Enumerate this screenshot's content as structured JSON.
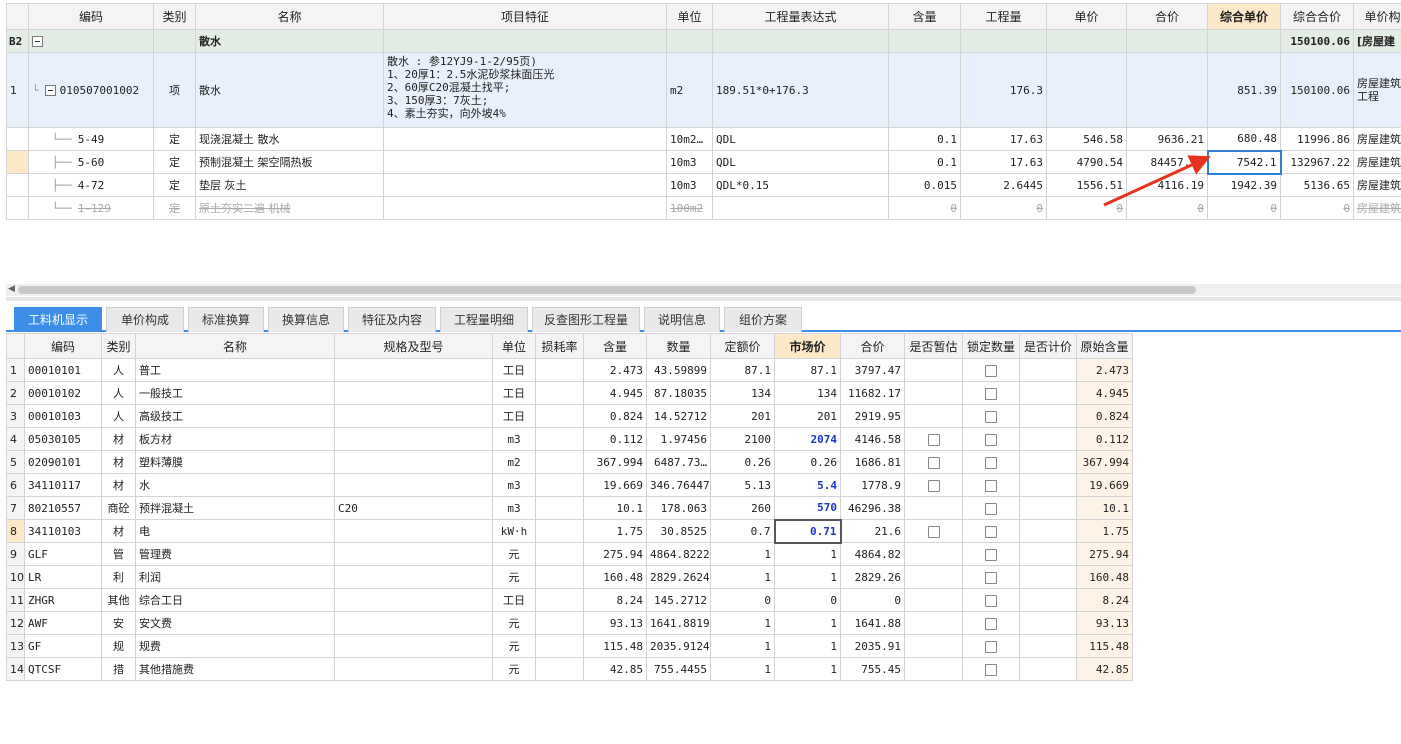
{
  "top": {
    "headers": [
      "编码",
      "类别",
      "名称",
      "项目特征",
      "单位",
      "工程量表达式",
      "含量",
      "工程量",
      "单价",
      "合价",
      "综合单价",
      "综合合价",
      "单价构"
    ],
    "group": {
      "idx": "B2",
      "name": "散水",
      "total": "150100.06",
      "spec": "[房屋建"
    },
    "item": {
      "idx": "1",
      "code": "010507001002",
      "type": "项",
      "name": "散水",
      "features": [
        "散水 : 参12YJ9-1-2/95页)",
        "1、20厚1：2.5水泥砂浆抹面压光",
        "2、60厚C20混凝土找平;",
        "3、150厚3：7灰土;",
        "4、素土夯实，向外坡4%"
      ],
      "unit": "m2",
      "expr": "189.51*0+176.3",
      "qty": "176.3",
      "comp_price": "851.39",
      "comp_total": "150100.06",
      "spec": "房屋建筑",
      "spec2": "工程"
    },
    "subitems": [
      {
        "code": "5-49",
        "type": "定",
        "name": "现浇混凝土 散水",
        "unit": "10m2…",
        "expr": "QDL",
        "content": "0.1",
        "qty": "17.63",
        "price": "546.58",
        "total": "9636.21",
        "comp_price": "680.48",
        "comp_total": "11996.86",
        "spec": "房屋建筑"
      },
      {
        "code": "5-60",
        "type": "定",
        "name": "预制混凝土 架空隔热板",
        "unit": "10m3",
        "expr": "QDL",
        "content": "0.1",
        "qty": "17.63",
        "price": "4790.54",
        "total": "84457.20",
        "comp_price": "7542.1",
        "comp_total": "132967.22",
        "spec": "房屋建筑"
      },
      {
        "code": "4-72",
        "type": "定",
        "name": "垫层 灰土",
        "unit": "10m3",
        "expr": "QDL*0.15",
        "content": "0.015",
        "qty": "2.6445",
        "price": "1556.51",
        "total": "4116.19",
        "comp_price": "1942.39",
        "comp_total": "5136.65",
        "spec": "房屋建筑"
      },
      {
        "code": "1-129",
        "type": "定",
        "name": "原土夯实二遍 机械",
        "unit": "100m2",
        "expr": "",
        "content": "0",
        "qty": "0",
        "price": "0",
        "total": "0",
        "comp_price": "0",
        "comp_total": "0",
        "spec": "房屋建筑"
      }
    ]
  },
  "tabs": [
    "工料机显示",
    "单价构成",
    "标准换算",
    "换算信息",
    "特征及内容",
    "工程量明细",
    "反查图形工程量",
    "说明信息",
    "组价方案"
  ],
  "bottom": {
    "headers": [
      "",
      "编码",
      "类别",
      "名称",
      "规格及型号",
      "单位",
      "损耗率",
      "含量",
      "数量",
      "定额价",
      "市场价",
      "合价",
      "是否暂估",
      "锁定数量",
      "是否计价",
      "原始含量"
    ],
    "rows": [
      {
        "n": "1",
        "code": "00010101",
        "type": "人",
        "name": "普工",
        "spec": "",
        "unit": "工日",
        "loss": "",
        "content": "2.473",
        "qty": "43.59899",
        "fixed": "87.1",
        "market": "87.1",
        "total": "3797.47",
        "orig": "2.473"
      },
      {
        "n": "2",
        "code": "00010102",
        "type": "人",
        "name": "一般技工",
        "spec": "",
        "unit": "工日",
        "loss": "",
        "content": "4.945",
        "qty": "87.18035",
        "fixed": "134",
        "market": "134",
        "total": "11682.17",
        "orig": "4.945"
      },
      {
        "n": "3",
        "code": "00010103",
        "type": "人",
        "name": "高级技工",
        "spec": "",
        "unit": "工日",
        "loss": "",
        "content": "0.824",
        "qty": "14.52712",
        "fixed": "201",
        "market": "201",
        "total": "2919.95",
        "orig": "0.824"
      },
      {
        "n": "4",
        "code": "05030105",
        "type": "材",
        "name": "板方材",
        "spec": "",
        "unit": "m3",
        "loss": "",
        "content": "0.112",
        "qty": "1.97456",
        "fixed": "2100",
        "market": "2074",
        "total": "4146.58",
        "orig": "0.112"
      },
      {
        "n": "5",
        "code": "02090101",
        "type": "材",
        "name": "塑料薄膜",
        "spec": "",
        "unit": "m2",
        "loss": "",
        "content": "367.994",
        "qty": "6487.73…",
        "fixed": "0.26",
        "market": "0.26",
        "total": "1686.81",
        "orig": "367.994"
      },
      {
        "n": "6",
        "code": "34110117",
        "type": "材",
        "name": "水",
        "spec": "",
        "unit": "m3",
        "loss": "",
        "content": "19.669",
        "qty": "346.76447",
        "fixed": "5.13",
        "market": "5.4",
        "total": "1778.9",
        "orig": "19.669"
      },
      {
        "n": "7",
        "code": "80210557",
        "type": "商砼",
        "name": "预拌混凝土",
        "spec": "C20",
        "unit": "m3",
        "loss": "",
        "content": "10.1",
        "qty": "178.063",
        "fixed": "260",
        "market": "570",
        "total": "46296.38",
        "orig": "10.1"
      },
      {
        "n": "8",
        "code": "34110103",
        "type": "材",
        "name": "电",
        "spec": "",
        "unit": "kW·h",
        "loss": "",
        "content": "1.75",
        "qty": "30.8525",
        "fixed": "0.7",
        "market": "0.71",
        "total": "21.6",
        "orig": "1.75"
      },
      {
        "n": "9",
        "code": "GLF",
        "type": "管",
        "name": "管理费",
        "spec": "",
        "unit": "元",
        "loss": "",
        "content": "275.94",
        "qty": "4864.8222",
        "fixed": "1",
        "market": "1",
        "total": "4864.82",
        "orig": "275.94"
      },
      {
        "n": "10",
        "code": "LR",
        "type": "利",
        "name": "利润",
        "spec": "",
        "unit": "元",
        "loss": "",
        "content": "160.48",
        "qty": "2829.2624",
        "fixed": "1",
        "market": "1",
        "total": "2829.26",
        "orig": "160.48"
      },
      {
        "n": "11",
        "code": "ZHGR",
        "type": "其他",
        "name": "综合工日",
        "spec": "",
        "unit": "工日",
        "loss": "",
        "content": "8.24",
        "qty": "145.2712",
        "fixed": "0",
        "market": "0",
        "total": "0",
        "orig": "8.24"
      },
      {
        "n": "12",
        "code": "AWF",
        "type": "安",
        "name": "安文费",
        "spec": "",
        "unit": "元",
        "loss": "",
        "content": "93.13",
        "qty": "1641.8819",
        "fixed": "1",
        "market": "1",
        "total": "1641.88",
        "orig": "93.13"
      },
      {
        "n": "13",
        "code": "GF",
        "type": "规",
        "name": "规费",
        "spec": "",
        "unit": "元",
        "loss": "",
        "content": "115.48",
        "qty": "2035.9124",
        "fixed": "1",
        "market": "1",
        "total": "2035.91",
        "orig": "115.48"
      },
      {
        "n": "14",
        "code": "QTCSF",
        "type": "措",
        "name": "其他措施费",
        "spec": "",
        "unit": "元",
        "loss": "",
        "content": "42.85",
        "qty": "755.4455",
        "fixed": "1",
        "market": "1",
        "total": "755.45",
        "orig": "42.85"
      }
    ]
  },
  "colors": {
    "accent": "#3c8ee8",
    "highlight_header": "#fde8c8",
    "blue_value": "#1a35c8",
    "arrow": "#e8321e"
  }
}
